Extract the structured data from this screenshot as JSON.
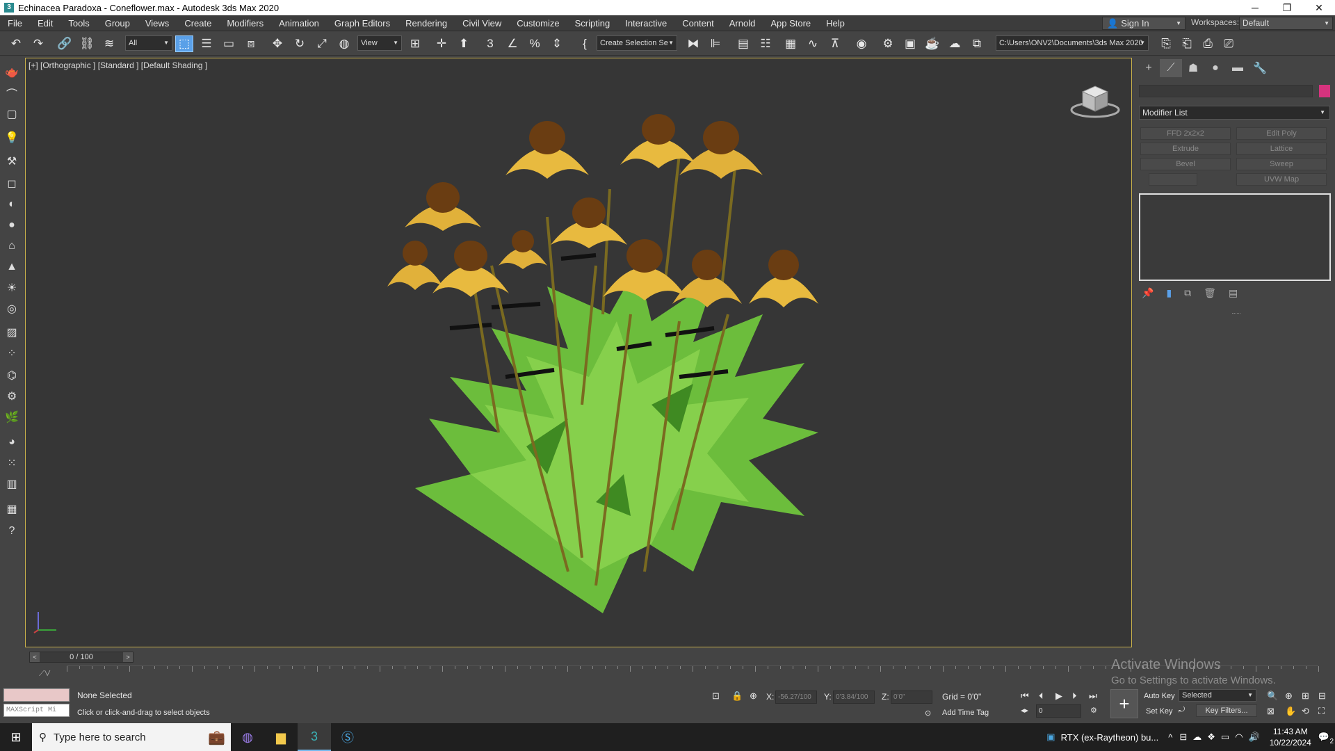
{
  "window": {
    "title": "Echinacea Paradoxa - Coneflower.max - Autodesk 3ds Max 2020",
    "controls": {
      "minimize": "─",
      "restore": "❐",
      "close": "✕"
    }
  },
  "menu": {
    "items": [
      "File",
      "Edit",
      "Tools",
      "Group",
      "Views",
      "Create",
      "Modifiers",
      "Animation",
      "Graph Editors",
      "Rendering",
      "Civil View",
      "Customize",
      "Scripting",
      "Interactive",
      "Content",
      "Arnold",
      "App Store",
      "Help"
    ],
    "sign_in": "Sign In",
    "workspaces_label": "Workspaces:",
    "workspace_value": "Default"
  },
  "toolbar": {
    "selection_filter": "All",
    "ref_coord": "View",
    "named_selection": "Create Selection Se",
    "project_path": "C:\\Users\\ONV2\\Documents\\3ds Max 2020"
  },
  "viewport": {
    "label": "[+] [Orthographic ] [Standard ] [Default Shading ]",
    "axis_y": "y",
    "axis_x": "x"
  },
  "command_panel": {
    "modifier_list": "Modifier List",
    "buttons": [
      "FFD 2x2x2",
      "Edit Poly",
      "Extrude",
      "Lattice",
      "Bevel",
      "Sweep",
      "",
      "UVW Map"
    ],
    "object_color": "#d6337e"
  },
  "timeline": {
    "frame": "0 / 100",
    "ticks": [
      "0",
      "5",
      "10",
      "15",
      "20",
      "25",
      "30",
      "35",
      "40",
      "45",
      "50",
      "55",
      "60",
      "65",
      "70",
      "75",
      "80",
      "85",
      "90",
      "95",
      "100"
    ]
  },
  "status": {
    "selection": "None Selected",
    "prompt": "Click or click-and-drag to select objects",
    "maxscript_placeholder": "MAXScript Mi",
    "x_label": "X:",
    "x_value": "-56.27/100",
    "y_label": "Y:",
    "y_value": "0'3.84/100",
    "z_label": "Z:",
    "z_value": "0'0\"",
    "grid": "Grid = 0'0\"",
    "add_time_tag": "Add Time Tag",
    "auto_key": "Auto Key",
    "set_key": "Set Key",
    "key_mode": "Selected",
    "key_filters": "Key Filters...",
    "frame_field": "0"
  },
  "watermark": {
    "line1": "Activate Windows",
    "line2": "Go to Settings to activate Windows."
  },
  "taskbar": {
    "search_placeholder": "Type here to search",
    "notification": "RTX (ex-Raytheon) bu...",
    "time": "11:43 AM",
    "date": "10/22/2024",
    "badge": "2"
  }
}
